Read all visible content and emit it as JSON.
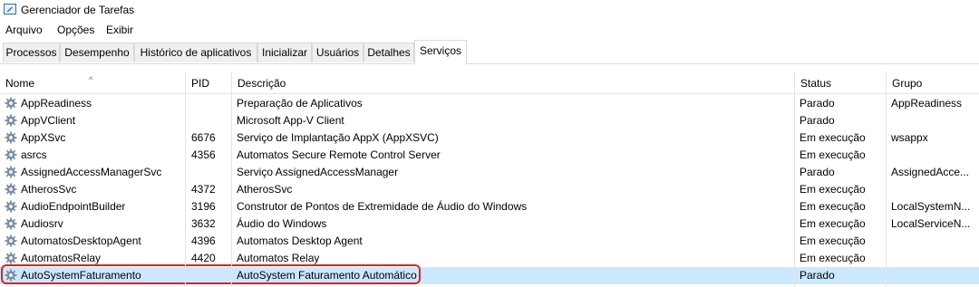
{
  "window": {
    "title": "Gerenciador de Tarefas"
  },
  "menu": [
    "Arquivo",
    "Opções",
    "Exibir"
  ],
  "tabs": [
    "Processos",
    "Desempenho",
    "Histórico de aplicativos",
    "Inicializar",
    "Usuários",
    "Detalhes",
    "Serviços"
  ],
  "active_tab": "Serviços",
  "columns": [
    "Nome",
    "PID",
    "Descrição",
    "Status",
    "Grupo"
  ],
  "sort_column": "Nome",
  "services": [
    {
      "name": "AppReadiness",
      "pid": "",
      "description": "Preparação de Aplicativos",
      "status": "Parado",
      "group": "AppReadiness"
    },
    {
      "name": "AppVClient",
      "pid": "",
      "description": "Microsoft App-V Client",
      "status": "Parado",
      "group": ""
    },
    {
      "name": "AppXSvc",
      "pid": "6676",
      "description": "Serviço de Implantação AppX (AppXSVC)",
      "status": "Em execução",
      "group": "wsappx"
    },
    {
      "name": "asrcs",
      "pid": "4356",
      "description": "Automatos Secure Remote Control Server",
      "status": "Em execução",
      "group": ""
    },
    {
      "name": "AssignedAccessManagerSvc",
      "pid": "",
      "description": "Serviço AssignedAccessManager",
      "status": "Parado",
      "group": "AssignedAcce..."
    },
    {
      "name": "AtherosSvc",
      "pid": "4372",
      "description": "AtherosSvc",
      "status": "Em execução",
      "group": ""
    },
    {
      "name": "AudioEndpointBuilder",
      "pid": "3196",
      "description": "Construtor de Pontos de Extremidade de Áudio do Windows",
      "status": "Em execução",
      "group": "LocalSystemN..."
    },
    {
      "name": "Audiosrv",
      "pid": "3632",
      "description": "Áudio do Windows",
      "status": "Em execução",
      "group": "LocalServiceN..."
    },
    {
      "name": "AutomatosDesktopAgent",
      "pid": "4396",
      "description": "Automatos Desktop Agent",
      "status": "Em execução",
      "group": ""
    },
    {
      "name": "AutomatosRelay",
      "pid": "4420",
      "description": "Automatos Relay",
      "status": "Em execução",
      "group": ""
    },
    {
      "name": "AutoSystemFaturamento",
      "pid": "",
      "description": "AutoSystem Faturamento Automático",
      "status": "Parado",
      "group": ""
    }
  ],
  "selected_service": "AutoSystemFaturamento",
  "colors": {
    "selection": "#cce8ff",
    "highlight_border": "#e02020",
    "gear": "#7a8ca0"
  },
  "icons": {
    "service": "gear-icon",
    "app": "task-manager-icon",
    "sort": "sort-up-arrow"
  }
}
